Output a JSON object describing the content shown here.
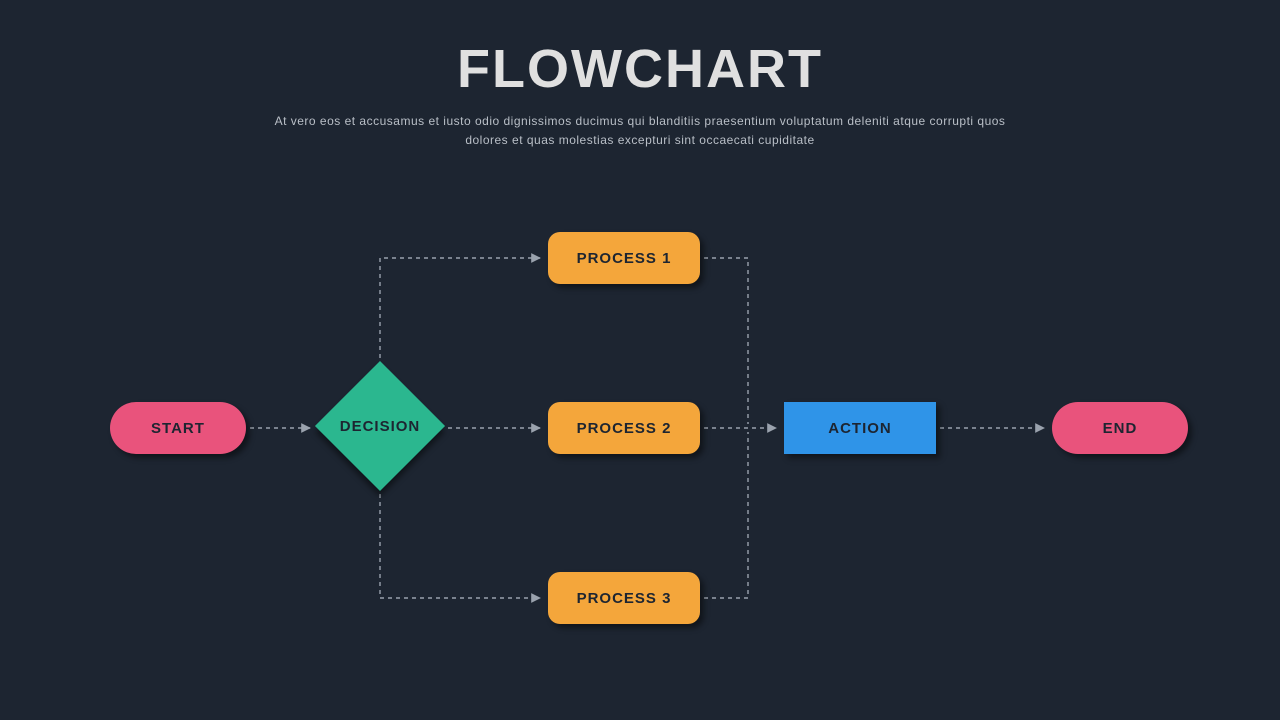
{
  "header": {
    "title": "FLOWCHART",
    "subtitle": "At vero eos et accusamus et iusto odio dignissimos ducimus qui blanditiis praesentium voluptatum deleniti atque corrupti quos dolores et quas molestias excepturi sint occaecati cupiditate"
  },
  "nodes": {
    "start": {
      "label": "START",
      "type": "terminator",
      "color": "#e9537c"
    },
    "decision": {
      "label": "DECISION",
      "type": "decision",
      "color": "#2bb78f"
    },
    "process1": {
      "label": "PROCESS 1",
      "type": "process",
      "color": "#f4a63b"
    },
    "process2": {
      "label": "PROCESS 2",
      "type": "process",
      "color": "#f4a63b"
    },
    "process3": {
      "label": "PROCESS 3",
      "type": "process",
      "color": "#f4a63b"
    },
    "action": {
      "label": "ACTION",
      "type": "action",
      "color": "#2f94e8"
    },
    "end": {
      "label": "END",
      "type": "terminator",
      "color": "#e9537c"
    }
  },
  "edges": [
    [
      "start",
      "decision"
    ],
    [
      "decision",
      "process1"
    ],
    [
      "decision",
      "process2"
    ],
    [
      "decision",
      "process3"
    ],
    [
      "process1",
      "action"
    ],
    [
      "process2",
      "action"
    ],
    [
      "process3",
      "action"
    ],
    [
      "action",
      "end"
    ]
  ],
  "colors": {
    "background": "#1d2531",
    "connector": "#9aa2ad"
  }
}
